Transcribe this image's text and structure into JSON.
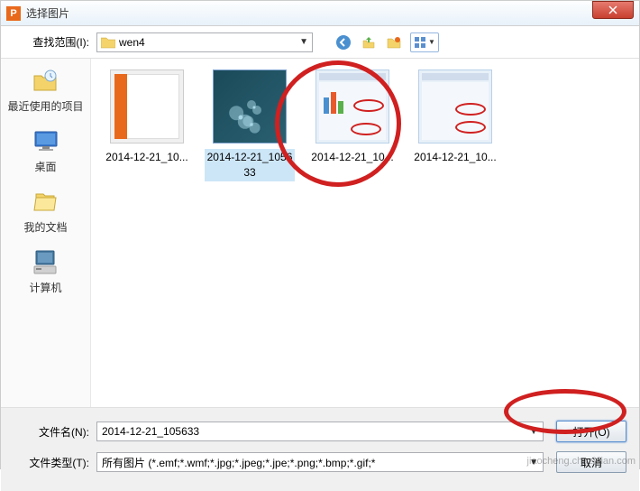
{
  "titlebar": {
    "title": "选择图片"
  },
  "toprow": {
    "label": "查找范围(I):",
    "folder": "wen4"
  },
  "sidebar": {
    "items": [
      {
        "label": "最近使用的项目"
      },
      {
        "label": "桌面"
      },
      {
        "label": "我的文档"
      },
      {
        "label": "计算机"
      }
    ]
  },
  "files": [
    {
      "label": "2014-12-21_10..."
    },
    {
      "label": "2014-12-21_105633"
    },
    {
      "label": "2014-12-21_10..."
    },
    {
      "label": "2014-12-21_10..."
    }
  ],
  "bottom": {
    "filename_label": "文件名(N):",
    "filename_value": "2014-12-21_105633",
    "filetype_label": "文件类型(T):",
    "filetype_value": "所有图片 (*.emf;*.wmf;*.jpg;*.jpeg;*.jpe;*.png;*.bmp;*.gif;*",
    "open_btn": "打开(O)",
    "cancel_btn": "取消"
  },
  "watermark": "jiaocheng.chazidian.com"
}
